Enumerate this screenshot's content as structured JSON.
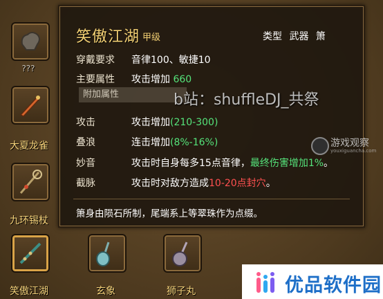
{
  "inventory": {
    "unknown_label": "???",
    "slots": [
      {
        "name": "大夏龙雀"
      },
      {
        "name": "九环锡杖"
      },
      {
        "name": "笑傲江湖"
      },
      {
        "name": "玄象"
      },
      {
        "name": "狮子丸"
      }
    ]
  },
  "tooltip": {
    "title": "笑傲江湖",
    "grade": "甲级",
    "type_label": "类型",
    "type_value": "武器 箫",
    "requirement_label": "穿戴要求",
    "requirement_value": "音律100、敏捷10",
    "main_attr_label": "主要属性",
    "main_attr_text": "攻击增加",
    "main_attr_value": "660",
    "extra_attr_header": "附加属性",
    "attrs": [
      {
        "label": "攻击",
        "text": "攻击增加",
        "value": "(210-300)",
        "suffix": ""
      },
      {
        "label": "叠浪",
        "text": "连击增加",
        "value": "(8%-16%)",
        "suffix": ""
      },
      {
        "label": "妙音",
        "text": "攻击时自身每多15点音律，",
        "value": "最终伤害增加1%",
        "suffix": "。"
      },
      {
        "label": "截脉",
        "text": "攻击时对敌方造成",
        "value": "10-20点封穴",
        "suffix": "。"
      }
    ],
    "description": "箫身由陨石所制，尾端系上等翠珠作为点缀。"
  },
  "overlay": {
    "watermark": "b站：shuffleDJ_共祭",
    "site_logo_text": "游戏观察",
    "site_logo_url": "youxiguancha.com",
    "brand_name": "优品软件园"
  }
}
